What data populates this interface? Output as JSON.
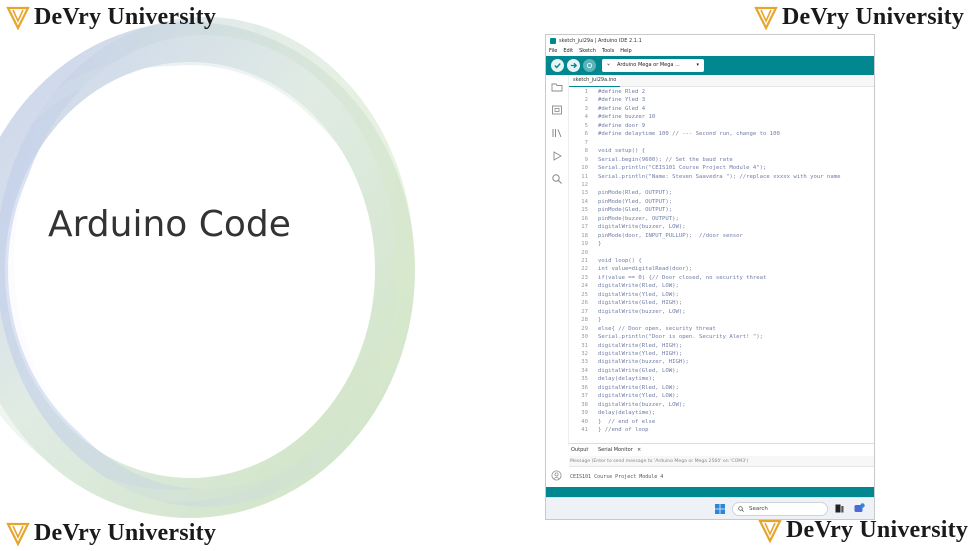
{
  "slide": {
    "title": "Arduino Code",
    "logo_text": "DeVry University"
  },
  "ide": {
    "window_title": "sketch_jul29a | Arduino IDE 2.1.1",
    "menu": [
      "File",
      "Edit",
      "Sketch",
      "Tools",
      "Help"
    ],
    "board": "Arduino Mega or Mega ...",
    "tab": "sketch_jul29a.ino",
    "code": [
      {
        "n": "1",
        "t": "#define Rled 2"
      },
      {
        "n": "2",
        "t": "#define Yled 3"
      },
      {
        "n": "3",
        "t": "#define Gled 4"
      },
      {
        "n": "4",
        "t": "#define buzzer 10"
      },
      {
        "n": "5",
        "t": "#define door 9"
      },
      {
        "n": "6",
        "t": "#define delaytime 100 // --- Second run, change to 100"
      },
      {
        "n": "7",
        "t": ""
      },
      {
        "n": "8",
        "t": "void setup() {"
      },
      {
        "n": "9",
        "t": "Serial.begin(9600); // Set the baud rate"
      },
      {
        "n": "10",
        "t": "Serial.println(\"CEIS101 Course Project Module 4\");"
      },
      {
        "n": "11",
        "t": "Serial.println(\"Name: Steven Saavedra \"); //replace xxxxx with your name"
      },
      {
        "n": "12",
        "t": ""
      },
      {
        "n": "13",
        "t": "pinMode(Rled, OUTPUT);"
      },
      {
        "n": "14",
        "t": "pinMode(Yled, OUTPUT);"
      },
      {
        "n": "15",
        "t": "pinMode(Gled, OUTPUT);"
      },
      {
        "n": "16",
        "t": "pinMode(buzzer, OUTPUT);"
      },
      {
        "n": "17",
        "t": "digitalWrite(buzzer, LOW);"
      },
      {
        "n": "18",
        "t": "pinMode(door, INPUT_PULLUP);  //door sensor"
      },
      {
        "n": "19",
        "t": "}"
      },
      {
        "n": "20",
        "t": ""
      },
      {
        "n": "21",
        "t": "void loop() {"
      },
      {
        "n": "22",
        "t": "int value=digitalRead(door);"
      },
      {
        "n": "23",
        "t": "if(value == 0) {// Door closed, no security threat"
      },
      {
        "n": "24",
        "t": "digitalWrite(Rled, LOW);"
      },
      {
        "n": "25",
        "t": "digitalWrite(Yled, LOW);"
      },
      {
        "n": "26",
        "t": "digitalWrite(Gled, HIGH);"
      },
      {
        "n": "27",
        "t": "digitalWrite(buzzer, LOW);"
      },
      {
        "n": "28",
        "t": "}"
      },
      {
        "n": "29",
        "t": "else{ // Door open, security threat"
      },
      {
        "n": "30",
        "t": "Serial.println(\"Door is open. Security Alert! \");"
      },
      {
        "n": "31",
        "t": "digitalWrite(Rled, HIGH);"
      },
      {
        "n": "32",
        "t": "digitalWrite(Yled, HIGH);"
      },
      {
        "n": "33",
        "t": "digitalWrite(buzzer, HIGH);"
      },
      {
        "n": "34",
        "t": "digitalWrite(Gled, LOW);"
      },
      {
        "n": "35",
        "t": "delay(delaytime);"
      },
      {
        "n": "36",
        "t": "digitalWrite(Rled, LOW);"
      },
      {
        "n": "37",
        "t": "digitalWrite(Yled, LOW);"
      },
      {
        "n": "38",
        "t": "digitalWrite(buzzer, LOW);"
      },
      {
        "n": "39",
        "t": "delay(delaytime);"
      },
      {
        "n": "40",
        "t": "}  // end of else"
      },
      {
        "n": "41",
        "t": "} //end of loop"
      }
    ],
    "bottom_tabs": {
      "output": "Output",
      "serial_monitor": "Serial Monitor",
      "close": "×"
    },
    "message_placeholder": "Message (Enter to send message to 'Arduino Mega or Mega 2560' on 'COM3')",
    "serial_output": "CEIS101 Course Project Module 4",
    "taskbar_search": "Search"
  },
  "colors": {
    "arduino_teal": "#00878f",
    "code_text": "#6f7ca6"
  }
}
